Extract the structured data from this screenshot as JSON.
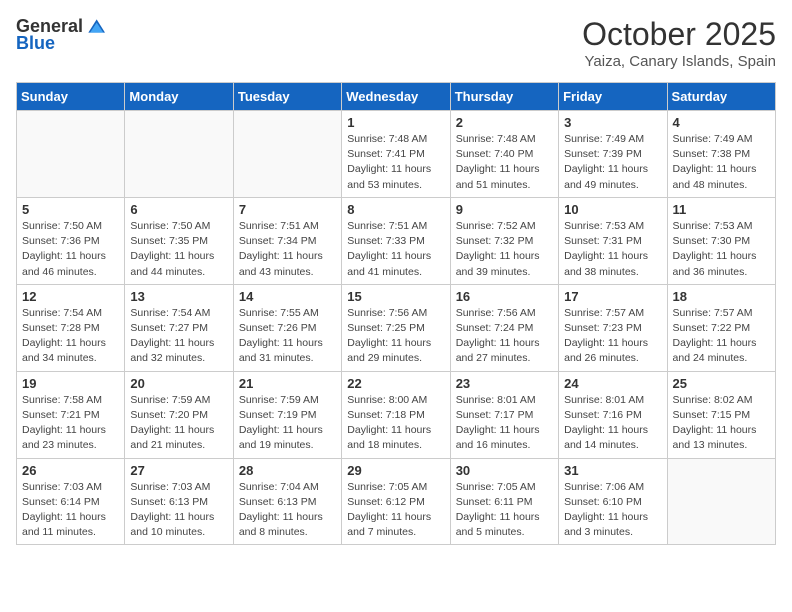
{
  "header": {
    "logo_general": "General",
    "logo_blue": "Blue",
    "title": "October 2025",
    "location": "Yaiza, Canary Islands, Spain"
  },
  "days_of_week": [
    "Sunday",
    "Monday",
    "Tuesday",
    "Wednesday",
    "Thursday",
    "Friday",
    "Saturday"
  ],
  "weeks": [
    [
      {
        "day": "",
        "detail": ""
      },
      {
        "day": "",
        "detail": ""
      },
      {
        "day": "",
        "detail": ""
      },
      {
        "day": "1",
        "detail": "Sunrise: 7:48 AM\nSunset: 7:41 PM\nDaylight: 11 hours\nand 53 minutes."
      },
      {
        "day": "2",
        "detail": "Sunrise: 7:48 AM\nSunset: 7:40 PM\nDaylight: 11 hours\nand 51 minutes."
      },
      {
        "day": "3",
        "detail": "Sunrise: 7:49 AM\nSunset: 7:39 PM\nDaylight: 11 hours\nand 49 minutes."
      },
      {
        "day": "4",
        "detail": "Sunrise: 7:49 AM\nSunset: 7:38 PM\nDaylight: 11 hours\nand 48 minutes."
      }
    ],
    [
      {
        "day": "5",
        "detail": "Sunrise: 7:50 AM\nSunset: 7:36 PM\nDaylight: 11 hours\nand 46 minutes."
      },
      {
        "day": "6",
        "detail": "Sunrise: 7:50 AM\nSunset: 7:35 PM\nDaylight: 11 hours\nand 44 minutes."
      },
      {
        "day": "7",
        "detail": "Sunrise: 7:51 AM\nSunset: 7:34 PM\nDaylight: 11 hours\nand 43 minutes."
      },
      {
        "day": "8",
        "detail": "Sunrise: 7:51 AM\nSunset: 7:33 PM\nDaylight: 11 hours\nand 41 minutes."
      },
      {
        "day": "9",
        "detail": "Sunrise: 7:52 AM\nSunset: 7:32 PM\nDaylight: 11 hours\nand 39 minutes."
      },
      {
        "day": "10",
        "detail": "Sunrise: 7:53 AM\nSunset: 7:31 PM\nDaylight: 11 hours\nand 38 minutes."
      },
      {
        "day": "11",
        "detail": "Sunrise: 7:53 AM\nSunset: 7:30 PM\nDaylight: 11 hours\nand 36 minutes."
      }
    ],
    [
      {
        "day": "12",
        "detail": "Sunrise: 7:54 AM\nSunset: 7:28 PM\nDaylight: 11 hours\nand 34 minutes."
      },
      {
        "day": "13",
        "detail": "Sunrise: 7:54 AM\nSunset: 7:27 PM\nDaylight: 11 hours\nand 32 minutes."
      },
      {
        "day": "14",
        "detail": "Sunrise: 7:55 AM\nSunset: 7:26 PM\nDaylight: 11 hours\nand 31 minutes."
      },
      {
        "day": "15",
        "detail": "Sunrise: 7:56 AM\nSunset: 7:25 PM\nDaylight: 11 hours\nand 29 minutes."
      },
      {
        "day": "16",
        "detail": "Sunrise: 7:56 AM\nSunset: 7:24 PM\nDaylight: 11 hours\nand 27 minutes."
      },
      {
        "day": "17",
        "detail": "Sunrise: 7:57 AM\nSunset: 7:23 PM\nDaylight: 11 hours\nand 26 minutes."
      },
      {
        "day": "18",
        "detail": "Sunrise: 7:57 AM\nSunset: 7:22 PM\nDaylight: 11 hours\nand 24 minutes."
      }
    ],
    [
      {
        "day": "19",
        "detail": "Sunrise: 7:58 AM\nSunset: 7:21 PM\nDaylight: 11 hours\nand 23 minutes."
      },
      {
        "day": "20",
        "detail": "Sunrise: 7:59 AM\nSunset: 7:20 PM\nDaylight: 11 hours\nand 21 minutes."
      },
      {
        "day": "21",
        "detail": "Sunrise: 7:59 AM\nSunset: 7:19 PM\nDaylight: 11 hours\nand 19 minutes."
      },
      {
        "day": "22",
        "detail": "Sunrise: 8:00 AM\nSunset: 7:18 PM\nDaylight: 11 hours\nand 18 minutes."
      },
      {
        "day": "23",
        "detail": "Sunrise: 8:01 AM\nSunset: 7:17 PM\nDaylight: 11 hours\nand 16 minutes."
      },
      {
        "day": "24",
        "detail": "Sunrise: 8:01 AM\nSunset: 7:16 PM\nDaylight: 11 hours\nand 14 minutes."
      },
      {
        "day": "25",
        "detail": "Sunrise: 8:02 AM\nSunset: 7:15 PM\nDaylight: 11 hours\nand 13 minutes."
      }
    ],
    [
      {
        "day": "26",
        "detail": "Sunrise: 7:03 AM\nSunset: 6:14 PM\nDaylight: 11 hours\nand 11 minutes."
      },
      {
        "day": "27",
        "detail": "Sunrise: 7:03 AM\nSunset: 6:13 PM\nDaylight: 11 hours\nand 10 minutes."
      },
      {
        "day": "28",
        "detail": "Sunrise: 7:04 AM\nSunset: 6:13 PM\nDaylight: 11 hours\nand 8 minutes."
      },
      {
        "day": "29",
        "detail": "Sunrise: 7:05 AM\nSunset: 6:12 PM\nDaylight: 11 hours\nand 7 minutes."
      },
      {
        "day": "30",
        "detail": "Sunrise: 7:05 AM\nSunset: 6:11 PM\nDaylight: 11 hours\nand 5 minutes."
      },
      {
        "day": "31",
        "detail": "Sunrise: 7:06 AM\nSunset: 6:10 PM\nDaylight: 11 hours\nand 3 minutes."
      },
      {
        "day": "",
        "detail": ""
      }
    ]
  ]
}
